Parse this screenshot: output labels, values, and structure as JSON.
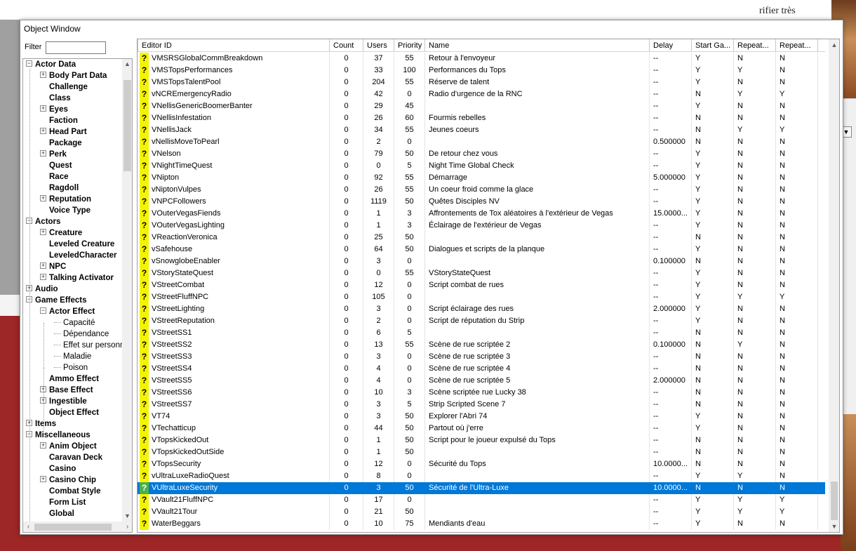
{
  "background": {
    "french_text": "rifier très"
  },
  "window": {
    "title": "Object Window",
    "filter_label": "Filter",
    "filter_value": ""
  },
  "tree": [
    {
      "label": "Actor Data",
      "level": 0,
      "expander": "−",
      "bold": true
    },
    {
      "label": "Body Part Data",
      "level": 1,
      "expander": "+",
      "bold": true
    },
    {
      "label": "Challenge",
      "level": 1,
      "expander": "",
      "bold": true
    },
    {
      "label": "Class",
      "level": 1,
      "expander": "",
      "bold": true
    },
    {
      "label": "Eyes",
      "level": 1,
      "expander": "+",
      "bold": true
    },
    {
      "label": "Faction",
      "level": 1,
      "expander": "",
      "bold": true
    },
    {
      "label": "Head Part",
      "level": 1,
      "expander": "+",
      "bold": true
    },
    {
      "label": "Package",
      "level": 1,
      "expander": "",
      "bold": true
    },
    {
      "label": "Perk",
      "level": 1,
      "expander": "+",
      "bold": true
    },
    {
      "label": "Quest",
      "level": 1,
      "expander": "",
      "bold": true
    },
    {
      "label": "Race",
      "level": 1,
      "expander": "",
      "bold": true
    },
    {
      "label": "Ragdoll",
      "level": 1,
      "expander": "",
      "bold": true
    },
    {
      "label": "Reputation",
      "level": 1,
      "expander": "+",
      "bold": true
    },
    {
      "label": "Voice Type",
      "level": 1,
      "expander": "",
      "bold": true
    },
    {
      "label": "Actors",
      "level": 0,
      "expander": "−",
      "bold": true
    },
    {
      "label": "Creature",
      "level": 1,
      "expander": "+",
      "bold": true
    },
    {
      "label": "Leveled Creature",
      "level": 1,
      "expander": "",
      "bold": true
    },
    {
      "label": "LeveledCharacter",
      "level": 1,
      "expander": "",
      "bold": true
    },
    {
      "label": "NPC",
      "level": 1,
      "expander": "+",
      "bold": true
    },
    {
      "label": "Talking Activator",
      "level": 1,
      "expander": "+",
      "bold": true
    },
    {
      "label": "Audio",
      "level": 0,
      "expander": "+",
      "bold": true
    },
    {
      "label": "Game Effects",
      "level": 0,
      "expander": "−",
      "bold": true
    },
    {
      "label": "Actor Effect",
      "level": 1,
      "expander": "−",
      "bold": true
    },
    {
      "label": "Capacité",
      "level": 2,
      "expander": "",
      "bold": false
    },
    {
      "label": "Dépendance",
      "level": 2,
      "expander": "",
      "bold": false
    },
    {
      "label": "Effet sur personn",
      "level": 2,
      "expander": "",
      "bold": false
    },
    {
      "label": "Maladie",
      "level": 2,
      "expander": "",
      "bold": false
    },
    {
      "label": "Poison",
      "level": 2,
      "expander": "",
      "bold": false
    },
    {
      "label": "Ammo Effect",
      "level": 1,
      "expander": "",
      "bold": true
    },
    {
      "label": "Base Effect",
      "level": 1,
      "expander": "+",
      "bold": true
    },
    {
      "label": "Ingestible",
      "level": 1,
      "expander": "+",
      "bold": true
    },
    {
      "label": "Object Effect",
      "level": 1,
      "expander": "",
      "bold": true
    },
    {
      "label": "Items",
      "level": 0,
      "expander": "+",
      "bold": true
    },
    {
      "label": "Miscellaneous",
      "level": 0,
      "expander": "−",
      "bold": true
    },
    {
      "label": "Anim Object",
      "level": 1,
      "expander": "+",
      "bold": true
    },
    {
      "label": "Caravan Deck",
      "level": 1,
      "expander": "",
      "bold": true
    },
    {
      "label": "Casino",
      "level": 1,
      "expander": "",
      "bold": true
    },
    {
      "label": "Casino Chip",
      "level": 1,
      "expander": "+",
      "bold": true
    },
    {
      "label": "Combat Style",
      "level": 1,
      "expander": "",
      "bold": true
    },
    {
      "label": "Form List",
      "level": 1,
      "expander": "",
      "bold": true
    },
    {
      "label": "Global",
      "level": 1,
      "expander": "",
      "bold": true
    }
  ],
  "columns": [
    "Editor ID",
    "Count",
    "Users",
    "Priority",
    "Name",
    "Delay",
    "Start Ga...",
    "Repeat...",
    "Repeat..."
  ],
  "rows": [
    [
      "VMSRSGlobalCommBreakdown",
      "0",
      "37",
      "55",
      "Retour à l'envoyeur",
      "--",
      "Y",
      "N",
      "N"
    ],
    [
      "VMSTopsPerformances",
      "0",
      "33",
      "100",
      "Performances du Tops",
      "--",
      "Y",
      "Y",
      "N"
    ],
    [
      "VMSTopsTalentPool",
      "0",
      "204",
      "55",
      "Réserve de talent",
      "--",
      "Y",
      "N",
      "N"
    ],
    [
      "vNCREmergencyRadio",
      "0",
      "42",
      "0",
      "Radio d'urgence de la RNC",
      "--",
      "N",
      "Y",
      "Y"
    ],
    [
      "VNellisGenericBoomerBanter",
      "0",
      "29",
      "45",
      "",
      "--",
      "Y",
      "N",
      "N"
    ],
    [
      "VNellisInfestation",
      "0",
      "26",
      "60",
      "Fourmis rebelles",
      "--",
      "N",
      "N",
      "N"
    ],
    [
      "VNellisJack",
      "0",
      "34",
      "55",
      "Jeunes coeurs",
      "--",
      "N",
      "Y",
      "Y"
    ],
    [
      "vNellisMoveToPearl",
      "0",
      "2",
      "0",
      "",
      "0.500000",
      "N",
      "N",
      "N"
    ],
    [
      "VNelson",
      "0",
      "79",
      "50",
      "De retour chez vous",
      "--",
      "Y",
      "N",
      "N"
    ],
    [
      "VNightTimeQuest",
      "0",
      "0",
      "5",
      "Night Time Global Check",
      "--",
      "Y",
      "N",
      "N"
    ],
    [
      "VNipton",
      "0",
      "92",
      "55",
      "Démarrage",
      "5.000000",
      "Y",
      "N",
      "N"
    ],
    [
      "vNiptonVulpes",
      "0",
      "26",
      "55",
      "Un coeur froid comme la glace",
      "--",
      "Y",
      "N",
      "N"
    ],
    [
      "VNPCFollowers",
      "0",
      "1119",
      "50",
      "Quêtes Disciples NV",
      "--",
      "Y",
      "N",
      "N"
    ],
    [
      "VOuterVegasFiends",
      "0",
      "1",
      "3",
      "Affrontements de Tox aléatoires à l'extérieur de Vegas",
      "15.0000...",
      "Y",
      "N",
      "N"
    ],
    [
      "VOuterVegasLighting",
      "0",
      "1",
      "3",
      "Éclairage de l'extérieur de Vegas",
      "--",
      "Y",
      "N",
      "N"
    ],
    [
      "VReactionVeronica",
      "0",
      "25",
      "50",
      "",
      "--",
      "N",
      "N",
      "N"
    ],
    [
      "vSafehouse",
      "0",
      "64",
      "50",
      "Dialogues et scripts de la planque",
      "--",
      "Y",
      "N",
      "N"
    ],
    [
      "vSnowglobeEnabler",
      "0",
      "3",
      "0",
      "",
      "0.100000",
      "N",
      "N",
      "N"
    ],
    [
      "VStoryStateQuest",
      "0",
      "0",
      "55",
      "VStoryStateQuest",
      "--",
      "Y",
      "N",
      "N"
    ],
    [
      "VStreetCombat",
      "0",
      "12",
      "0",
      "Script combat de rues",
      "--",
      "Y",
      "N",
      "N"
    ],
    [
      "VStreetFluffNPC",
      "0",
      "105",
      "0",
      "",
      "--",
      "Y",
      "Y",
      "Y"
    ],
    [
      "VStreetLighting",
      "0",
      "3",
      "0",
      "Script éclairage des rues",
      "2.000000",
      "Y",
      "N",
      "N"
    ],
    [
      "VStreetReputation",
      "0",
      "2",
      "0",
      "Script de réputation du Strip",
      "--",
      "Y",
      "N",
      "N"
    ],
    [
      "VStreetSS1",
      "0",
      "6",
      "5",
      "",
      "--",
      "N",
      "N",
      "N"
    ],
    [
      "VStreetSS2",
      "0",
      "13",
      "55",
      "Scène de rue scriptée 2",
      "0.100000",
      "N",
      "Y",
      "N"
    ],
    [
      "VStreetSS3",
      "0",
      "3",
      "0",
      "Scène de rue scriptée 3",
      "--",
      "N",
      "N",
      "N"
    ],
    [
      "VStreetSS4",
      "0",
      "4",
      "0",
      "Scène de rue scriptée 4",
      "--",
      "N",
      "N",
      "N"
    ],
    [
      "VStreetSS5",
      "0",
      "4",
      "0",
      "Scène de rue scriptée 5",
      "2.000000",
      "N",
      "N",
      "N"
    ],
    [
      "VStreetSS6",
      "0",
      "10",
      "3",
      "Scène scriptée rue Lucky 38",
      "--",
      "N",
      "N",
      "N"
    ],
    [
      "VStreetSS7",
      "0",
      "3",
      "5",
      "Strip Scripted Scene 7",
      "--",
      "N",
      "N",
      "N"
    ],
    [
      "VT74",
      "0",
      "3",
      "50",
      "Explorer l'Abri 74",
      "--",
      "Y",
      "N",
      "N"
    ],
    [
      "VTechatticup",
      "0",
      "44",
      "50",
      "Partout où j'erre",
      "--",
      "Y",
      "N",
      "N"
    ],
    [
      "VTopsKickedOut",
      "0",
      "1",
      "50",
      "Script pour le joueur expulsé du Tops",
      "--",
      "N",
      "N",
      "N"
    ],
    [
      "VTopsKickedOutSide",
      "0",
      "1",
      "50",
      "",
      "--",
      "N",
      "N",
      "N"
    ],
    [
      "VTopsSecurity",
      "0",
      "12",
      "0",
      "Sécurité du Tops",
      "10.0000...",
      "N",
      "N",
      "N"
    ],
    [
      "vUltraLuxeRadioQuest",
      "0",
      "8",
      "0",
      "",
      "--",
      "Y",
      "Y",
      "N"
    ],
    [
      "VUltraLuxeSecurity",
      "0",
      "3",
      "50",
      "Sécurité de l'Ultra-Luxe",
      "10.0000...",
      "N",
      "N",
      "N"
    ],
    [
      "VVault21FluffNPC",
      "0",
      "17",
      "0",
      "",
      "--",
      "Y",
      "Y",
      "Y"
    ],
    [
      "VVault21Tour",
      "0",
      "21",
      "50",
      "",
      "--",
      "Y",
      "Y",
      "Y"
    ],
    [
      "WaterBeggars",
      "0",
      "10",
      "75",
      "Mendiants d'eau",
      "--",
      "Y",
      "N",
      "N"
    ]
  ],
  "selected_row": 36,
  "colors": {
    "selection": "#0078d7",
    "question_icon_bg": "#f4f400",
    "question_icon_selected_bg": "#4bb04b"
  },
  "icons": {
    "row_icon": "question-mark-icon",
    "row_icon_glyph": "?",
    "expand_glyph": "+",
    "collapse_glyph": "−",
    "scroll_up": "▲",
    "scroll_down": "▼",
    "scroll_left": "‹",
    "scroll_right": "›"
  }
}
